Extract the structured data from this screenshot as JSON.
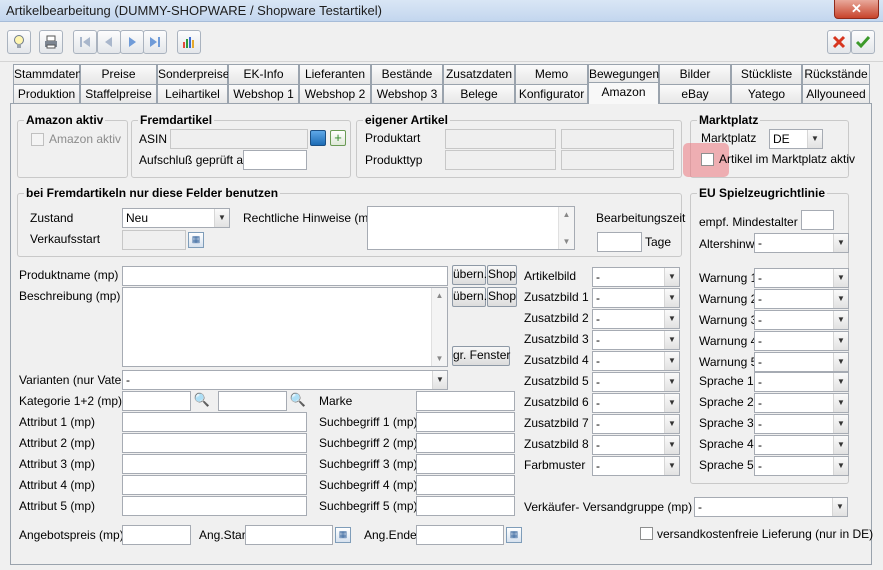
{
  "window": {
    "title": "Artikelbearbeitung (DUMMY-SHOPWARE / Shopware Testartikel)",
    "close_label": "✕"
  },
  "toolbar": {
    "left_icons": [
      "lightbulb-icon",
      "printer-icon",
      "first-record-icon",
      "previous-record-icon",
      "next-record-icon",
      "last-record-icon",
      "statistics-chart-icon"
    ],
    "cancel_icon": "cancel-x-icon",
    "ok_icon": "ok-check-icon",
    "colors": {
      "cancel": "#d7361f",
      "ok": "#3c9a2b"
    }
  },
  "tabs": {
    "row1": [
      "Stammdaten",
      "Preise",
      "Sonderpreise",
      "EK-Info",
      "Lieferanten",
      "Bestände",
      "Zusatzdaten",
      "Memo",
      "Bewegungen",
      "Bilder",
      "Stückliste",
      "Rückstände"
    ],
    "row2": [
      "Produktion",
      "Staffelpreise",
      "Leihartikel",
      "Webshop 1",
      "Webshop 2",
      "Webshop 3",
      "Belege",
      "Konfigurator",
      "Amazon",
      "eBay",
      "Yatego",
      "Allyouneed"
    ],
    "active": "Amazon"
  },
  "amazon_aktiv": {
    "title": "Amazon aktiv",
    "checkbox_label": "Amazon aktiv"
  },
  "fremdartikel": {
    "title": "Fremdartikel",
    "asin_label": "ASIN",
    "aufschluss_label": "Aufschluß geprüft am"
  },
  "eigener_artikel": {
    "title": "eigener Artikel",
    "produktart_label": "Produktart",
    "produkttyp_label": "Produkttyp"
  },
  "marktplatz": {
    "title": "Marktplatz",
    "marktplatz_label": "Marktplatz",
    "marktplatz_value": "DE",
    "aktiv_label": "Artikel im Marktplatz aktiv",
    "highlight_color": "#ec7880"
  },
  "fremd_felder": {
    "title": "bei Fremdartikeln nur diese Felder benutzen",
    "zustand_label": "Zustand",
    "zustand_value": "Neu",
    "verkaufsstart_label": "Verkaufsstart",
    "rechtliche_label": "Rechtliche Hinweise (mp)",
    "bearbeitungszeit_label": "Bearbeitungszeit",
    "tage_label": "Tage"
  },
  "eu": {
    "title": "EU Spielzeugrichtlinie",
    "mindestalter_label": "empf. Mindestalter",
    "altershinw_label": "Altershinw.",
    "altershinw_value": "-",
    "warnungen": [
      {
        "label": "Warnung 1",
        "value": "-"
      },
      {
        "label": "Warnung 2",
        "value": "-"
      },
      {
        "label": "Warnung 3",
        "value": "-"
      },
      {
        "label": "Warnung 4",
        "value": "-"
      },
      {
        "label": "Warnung 5",
        "value": "-"
      }
    ],
    "sprachen": [
      {
        "label": "Sprache 1",
        "value": "-"
      },
      {
        "label": "Sprache 2",
        "value": "-"
      },
      {
        "label": "Sprache 3",
        "value": "-"
      },
      {
        "label": "Sprache 4",
        "value": "-"
      },
      {
        "label": "Sprache 5",
        "value": "-"
      }
    ]
  },
  "product": {
    "produktname_label": "Produktname (mp)",
    "beschreibung_label": "Beschreibung (mp)",
    "uebern_label": "übern.",
    "shop_label": "Shop",
    "fenster_label": "gr. Fenster",
    "varianten_label": "Varianten (nur Vater)",
    "varianten_value": "-",
    "kategorie_label": "Kategorie 1+2 (mp)",
    "attribute": [
      "Attribut 1 (mp)",
      "Attribut 2 (mp)",
      "Attribut 3 (mp)",
      "Attribut 4 (mp)",
      "Attribut 5 (mp)"
    ],
    "marke_label": "Marke",
    "suchbegriffe": [
      "Suchbegriff 1 (mp)",
      "Suchbegriff 2 (mp)",
      "Suchbegriff 3 (mp)",
      "Suchbegriff 4 (mp)",
      "Suchbegriff 5 (mp)"
    ]
  },
  "bilder": [
    {
      "label": "Artikelbild",
      "value": "-"
    },
    {
      "label": "Zusatzbild 1",
      "value": "-"
    },
    {
      "label": "Zusatzbild 2",
      "value": "-"
    },
    {
      "label": "Zusatzbild 3",
      "value": "-"
    },
    {
      "label": "Zusatzbild 4",
      "value": "-"
    },
    {
      "label": "Zusatzbild 5",
      "value": "-"
    },
    {
      "label": "Zusatzbild 6",
      "value": "-"
    },
    {
      "label": "Zusatzbild 7",
      "value": "-"
    },
    {
      "label": "Zusatzbild 8",
      "value": "-"
    },
    {
      "label": "Farbmuster",
      "value": "-"
    }
  ],
  "versand": {
    "label": "Verkäufer- Versandgruppe (mp)",
    "value": "-"
  },
  "bottom": {
    "angebotspreis_label": "Angebotspreis (mp)",
    "angstart_label": "Ang.Start",
    "angende_label": "Ang.Ende",
    "versandkostenfrei_label": "versandkostenfreie Lieferung (nur in DE)"
  }
}
